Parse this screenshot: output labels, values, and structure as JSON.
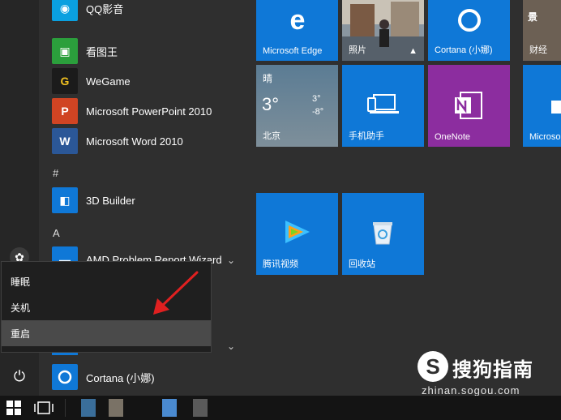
{
  "apps": [
    {
      "label": "QQ影音",
      "icon": "qq-player-icon",
      "color": "#0aa0e0",
      "glyph": "◉"
    },
    {
      "label": "看图王",
      "icon": "image-viewer-icon",
      "color": "#2b9f3c",
      "glyph": "▣"
    },
    {
      "label": "WeGame",
      "icon": "wegame-icon",
      "color": "#1b1b1b",
      "glyph": "G"
    },
    {
      "label": "Microsoft PowerPoint 2010",
      "icon": "powerpoint-icon",
      "color": "#d04423",
      "glyph": "P"
    },
    {
      "label": "Microsoft Word 2010",
      "icon": "word-icon",
      "color": "#2b5797",
      "glyph": "W"
    },
    {
      "label": "3D Builder",
      "icon": "3d-builder-icon",
      "color": "#0f78d7",
      "glyph": "◧"
    },
    {
      "label": "AMD Problem Report Wizard",
      "icon": "folder-icon",
      "color": "#0f78d7",
      "glyph": "▬"
    },
    {
      "label": "Cortana (小娜)",
      "icon": "cortana-icon",
      "color": "#0f78d7",
      "glyph": "○"
    }
  ],
  "letters": [
    "#",
    "A"
  ],
  "power_menu": {
    "items": [
      "睡眠",
      "关机",
      "重启"
    ],
    "selected": "重启"
  },
  "tiles": {
    "edge": {
      "label": "Microsoft Edge"
    },
    "photos": {
      "label": "照片"
    },
    "cortana": {
      "label": "Cortana (小娜)"
    },
    "finance": {
      "label": "财经",
      "top": "景"
    },
    "weather": {
      "condition": "晴",
      "temp": "3°",
      "high": "3°",
      "low": "-8°",
      "city": "北京"
    },
    "phone": {
      "label": "手机助手"
    },
    "onenote": {
      "label": "OneNote"
    },
    "store": {
      "label": "Microso"
    },
    "tencent_video": {
      "label": "腾讯视频"
    },
    "recycle": {
      "label": "回收站"
    }
  },
  "watermark": {
    "brand": "搜狗指南",
    "url": "zhinan.sogou.com"
  },
  "colors": {
    "tile_blue": "#0f78d7",
    "onenote": "#8c2d9f",
    "arrow": "#e02020"
  }
}
